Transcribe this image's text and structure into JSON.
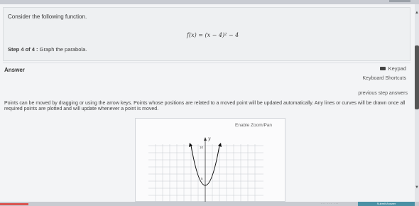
{
  "question": {
    "intro": "Consider the following function.",
    "function": "f(x) = (x − 4)² − 4",
    "step_label": "Step 4 of 4 :",
    "step_text": "Graph the parabola."
  },
  "answer": {
    "label": "Answer",
    "keypad": "Keypad",
    "shortcuts": "Keyboard Shortcuts",
    "previous": "previous step answers",
    "instructions": "Points can be moved by dragging or using the arrow keys. Points whose positions are related to a moved point will be updated automatically. Any lines or curves will be drawn once all required points are plotted and will update whenever a point is moved."
  },
  "graph": {
    "zoom_label": "Enable Zoom/Pan",
    "y_axis_label": "y",
    "tick_top": "10",
    "tick_mid": "5"
  },
  "footer": {
    "submit_label": "Submit Answer"
  },
  "colors": {
    "submit": "#4a90a4",
    "accent_red": "#d9534f"
  }
}
